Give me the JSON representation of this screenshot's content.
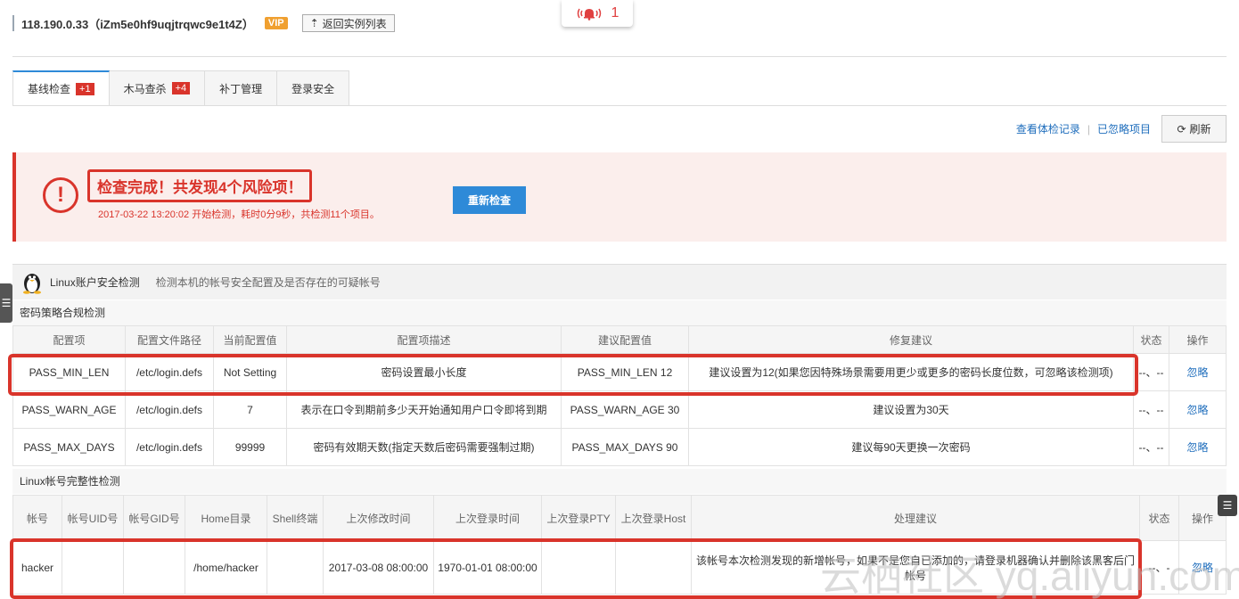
{
  "header": {
    "instance_title": "118.190.0.33（iZm5e0hf9uqjtrqwc9e1t4Z）",
    "vip_label": "VIP",
    "back_label": "返回实例列表",
    "alert_count": "1"
  },
  "tabs": [
    {
      "label": "基线检查",
      "count": "+1"
    },
    {
      "label": "木马查杀",
      "count": "+4"
    },
    {
      "label": "补丁管理",
      "count": ""
    },
    {
      "label": "登录安全",
      "count": ""
    }
  ],
  "actions": {
    "history_link": "查看体检记录",
    "ignored_link": "已忽略项目",
    "refresh_label": "刷新"
  },
  "result": {
    "title": "检查完成！共发现4个风险项！",
    "subtitle": "2017-03-22 13:20:02 开始检测，耗时0分9秒，共检测11个项目。",
    "recheck_label": "重新检查"
  },
  "section": {
    "name": "Linux账户安全检测",
    "description": "检测本机的帐号安全配置及是否存在的可疑帐号"
  },
  "password_policy": {
    "title": "密码策略合规检测",
    "columns": [
      "配置项",
      "配置文件路径",
      "当前配置值",
      "配置项描述",
      "建议配置值",
      "修复建议",
      "状态",
      "操作"
    ],
    "rows": [
      {
        "item": "PASS_MIN_LEN",
        "path": "/etc/login.defs",
        "current": "Not Setting",
        "desc": "密码设置最小长度",
        "suggest": "PASS_MIN_LEN 12",
        "fix": "建议设置为12(如果您因特殊场景需要用更少或更多的密码长度位数，可忽略该检测项)",
        "status": "--、--",
        "op": "忽略"
      },
      {
        "item": "PASS_WARN_AGE",
        "path": "/etc/login.defs",
        "current": "7",
        "desc": "表示在口令到期前多少天开始通知用户口令即将到期",
        "suggest": "PASS_WARN_AGE 30",
        "fix": "建议设置为30天",
        "status": "--、--",
        "op": "忽略"
      },
      {
        "item": "PASS_MAX_DAYS",
        "path": "/etc/login.defs",
        "current": "99999",
        "desc": "密码有效期天数(指定天数后密码需要强制过期)",
        "suggest": "PASS_MAX_DAYS 90",
        "fix": "建议每90天更换一次密码",
        "status": "--、--",
        "op": "忽略"
      }
    ]
  },
  "account_integrity": {
    "title": "Linux帐号完整性检测",
    "columns": [
      "帐号",
      "帐号UID号",
      "帐号GID号",
      "Home目录",
      "Shell终端",
      "上次修改时间",
      "上次登录时间",
      "上次登录PTY",
      "上次登录Host",
      "处理建议",
      "状态",
      "操作"
    ],
    "rows": [
      {
        "account": "hacker",
        "uid": "",
        "gid": "",
        "home": "/home/hacker",
        "shell": "",
        "modified": "2017-03-08 08:00:00",
        "last_login": "1970-01-01 08:00:00",
        "pty": "",
        "host": "",
        "advice": "该帐号本次检测发现的新增帐号，如果不是您自已添加的，请登录机器确认并删除该黑客后门帐号",
        "status": "--、-",
        "op": "忽略"
      }
    ]
  },
  "watermark": "云栖社区 yq.aliyun.com",
  "colors": {
    "accent": "#2e8ad8",
    "danger": "#d9342b",
    "link": "#1e6dbc"
  }
}
